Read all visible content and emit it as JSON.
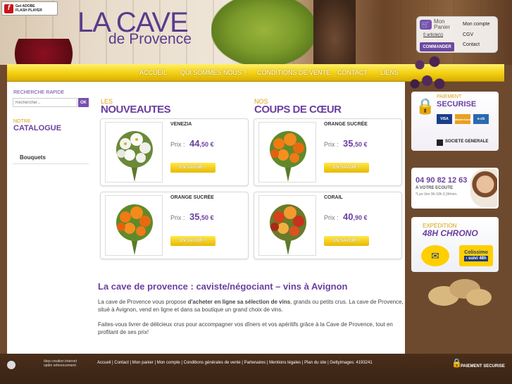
{
  "flash_badge": {
    "line1": "Get ADOBE",
    "line2": "FLASH PLAYER"
  },
  "logo": {
    "title": "LA CAVE",
    "subtitle": "de Provence"
  },
  "cart": {
    "panier_label": "Mon Panier",
    "articles": "0 article(s)",
    "commander": "COMMANDER",
    "links": [
      "Mon compte",
      "CGV",
      "Contact"
    ]
  },
  "nav": {
    "items": [
      "ACCUEIL",
      "QUI SOMMES NOUS ?",
      "CONDITIONS DE VENTE",
      "CONTACT",
      "LIENS"
    ]
  },
  "sidebar": {
    "search_title": "RECHERCHE RAPIDE",
    "search_placeholder": "Rechercher...",
    "ok": "OK",
    "notre": "NOTRE",
    "catalogue": "CATALOGUE",
    "items": [
      "Bouquets"
    ]
  },
  "sections": {
    "nouveautes_small": "LES",
    "nouveautes_big": "NOUVEAUTES",
    "coups_small": "NOS",
    "coups_big": "COUPS DE CŒUR"
  },
  "products": [
    {
      "name": "VENEZIA",
      "prix_label": "Prix :",
      "price_main": "44",
      "price_cents": ",50 €",
      "cta": "EN SAVOIR +"
    },
    {
      "name": "ORANGE SUCRÉE",
      "prix_label": "Prix :",
      "price_main": "35",
      "price_cents": ",50 €",
      "cta": "EN SAVOIR +"
    },
    {
      "name": "ORANGE SUCRÉE",
      "prix_label": "Prix :",
      "price_main": "35",
      "price_cents": ",50 €",
      "cta": "EN SAVOIR +"
    },
    {
      "name": "CORAIL",
      "prix_label": "Prix :",
      "price_main": "40",
      "price_cents": ",90 €",
      "cta": "EN SAVOIR +"
    }
  ],
  "intro": {
    "title": "La cave de provence : caviste/négociant – vins à Avignon",
    "p1_before": "La cave de Provence vous propose ",
    "p1_bold": "d'acheter en ligne sa sélection de vins",
    "p1_after": ", grands ou petits crus. La cave de Provence, situé à Avignon, vend en ligne et dans sa boutique un grand choix de vins.",
    "p2": "Faites-vous livrer de délicieux crus pour accompagner vos dîners et vos apéritifs grâce à la Cave de Provence, tout en profitant de ses prix!"
  },
  "payment_box": {
    "small": "PAIEMENT",
    "big": "SECURISE",
    "bank": "SOCIETE GENERALE",
    "cards": [
      "VISA",
      "MasterCard",
      "e-cb"
    ]
  },
  "phone_box": {
    "number": "04 90 82 12 63",
    "ecoute": "A VOTRE ECOUTE",
    "hours": "*Lun-Ven 9h-18h 0,34/min."
  },
  "shipping_box": {
    "small": "EXPÉDITION",
    "big": "48H CHRONO",
    "colissimo": "Colissimo",
    "suivi": "› suivi 48h"
  },
  "footer": {
    "agency": [
      "Idep creation internet",
      "optim referencement"
    ],
    "links": "Accueil | Contact | Mon panier | Mon compte | Conditions générales de vente | Partenaires | Mentions légales | Plan du site | Gettyimages: 4193241",
    "pay_secure": "PAIEMENT SECURISE"
  },
  "colors": {
    "purple": "#6b3fa0",
    "gold": "#e0a010",
    "nav_yellow": "#f3cf10",
    "footer_brown": "#4a2e1a"
  }
}
